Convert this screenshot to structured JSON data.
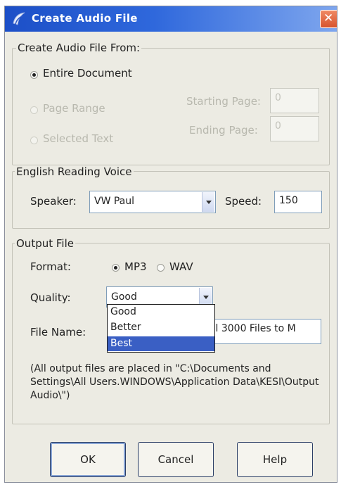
{
  "window": {
    "title": "Create Audio File",
    "close_glyph": "✕"
  },
  "source": {
    "legend": "Create Audio File From:",
    "options": [
      "Entire Document",
      "Page Range",
      "Selected Text"
    ],
    "selected": "Entire Document",
    "starting_page_label": "Starting Page:",
    "starting_page_value": "0",
    "ending_page_label": "Ending Page:",
    "ending_page_value": "0"
  },
  "voice": {
    "legend": "English Reading Voice",
    "speaker_label": "Speaker:",
    "speaker_value": "VW Paul",
    "speed_label": "Speed:",
    "speed_value": "150"
  },
  "output": {
    "legend": "Output File",
    "format_label": "Format:",
    "format_options": [
      "MP3",
      "WAV"
    ],
    "format_selected": "MP3",
    "quality_label": "Quality:",
    "quality_value": "Good",
    "quality_options": [
      "Good",
      "Better",
      "Best"
    ],
    "quality_highlighted": "Best",
    "filename_label": "File Name:",
    "filename_value": "ell 3000 Files to M",
    "note": "(All output files are placed in \"C:\\Documents and Settings\\All Users.WINDOWS\\Application Data\\KESI\\Output Audio\\\")"
  },
  "buttons": {
    "ok": "OK",
    "cancel": "Cancel",
    "help": "Help"
  },
  "colors": {
    "titlebar": "#2f68dc",
    "highlight": "#3a5fc4",
    "dialog_bg": "#ecebe3"
  },
  "icons": {
    "app": "app-icon",
    "close": "close-icon",
    "dropdown": "chevron-down-icon"
  }
}
